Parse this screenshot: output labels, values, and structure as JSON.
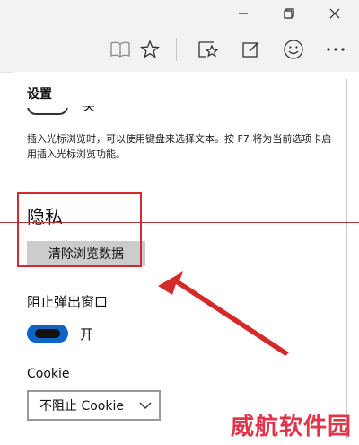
{
  "window": {
    "controls": [
      "minimize-icon",
      "maximize-icon",
      "close-icon"
    ]
  },
  "toolbar": {
    "icons": [
      "reading-view-icon",
      "favorite-star-icon",
      "hub-favorites-icon",
      "web-note-icon",
      "feedback-smiley-icon",
      "more-icon"
    ]
  },
  "settings": {
    "title": "设置",
    "top_toggle_label": "关",
    "caret_browsing_description": "插入光标浏览时，可以使用键盘来选择文本。按 F7 将为当前选项卡启用插入光标浏览功能。",
    "privacy": {
      "title": "隐私",
      "clear_button": "清除浏览数据"
    },
    "popup_blocker": {
      "label": "阻止弹出窗口",
      "state_text": "开",
      "on": true,
      "accent": "#0e63c7"
    },
    "cookie": {
      "label": "Cookie",
      "selected": "不阻止 Cookie"
    }
  },
  "annotation": {
    "color": "#d42a2a"
  },
  "watermark": {
    "text": "威航软件园",
    "color": "#e0354a"
  }
}
